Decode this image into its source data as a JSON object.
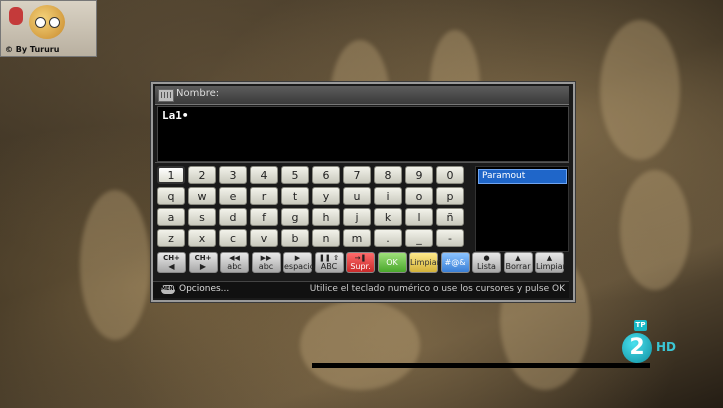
{
  "logo": {
    "caption": "© By Tururu"
  },
  "dialog": {
    "title": "Nombre:",
    "text_value": "La1•",
    "keyboard": {
      "rows": [
        [
          "1",
          "2",
          "3",
          "4",
          "5",
          "6",
          "7",
          "8",
          "9",
          "0"
        ],
        [
          "q",
          "w",
          "e",
          "r",
          "t",
          "y",
          "u",
          "i",
          "o",
          "p"
        ],
        [
          "a",
          "s",
          "d",
          "f",
          "g",
          "h",
          "j",
          "k",
          "l",
          "ñ"
        ],
        [
          "z",
          "x",
          "c",
          "v",
          "b",
          "n",
          "m",
          ".",
          "_",
          "-"
        ]
      ],
      "selected": "1"
    },
    "list": {
      "items": [
        "Paramout"
      ],
      "selected": "Paramout"
    },
    "function_keys": [
      {
        "top": "CH+",
        "label": "◀",
        "color": "grey"
      },
      {
        "top": "CH+",
        "label": "▶",
        "color": "grey"
      },
      {
        "top": "◀◀",
        "label": "abc",
        "color": "grey"
      },
      {
        "top": "▶▶",
        "label": "abc",
        "color": "grey"
      },
      {
        "top": "▶",
        "label": "espacio",
        "color": "grey"
      },
      {
        "top": "❚❚ ⇧",
        "label": "ABC",
        "color": "grey"
      },
      {
        "top": "→❚",
        "label": "Supr.",
        "color": "red"
      },
      {
        "top": "",
        "label": "OK",
        "color": "green"
      },
      {
        "top": "",
        "label": "Limpiar",
        "color": "yellow"
      },
      {
        "top": "",
        "label": "#@&",
        "color": "blue"
      },
      {
        "top": "●",
        "label": "Lista",
        "color": "grey"
      },
      {
        "top": "▲",
        "label": "Borrar",
        "color": "grey"
      },
      {
        "top": "▲",
        "label": "Limpiar",
        "color": "grey"
      }
    ],
    "footer": {
      "menu_icon": "MENU",
      "options_label": "Opciones...",
      "hint": "Utilice el teclado numérico o use los cursores y pulse OK"
    }
  },
  "channel": {
    "badge": "TP",
    "number": "2",
    "suffix": "HD",
    "color": "#19b9c7"
  }
}
